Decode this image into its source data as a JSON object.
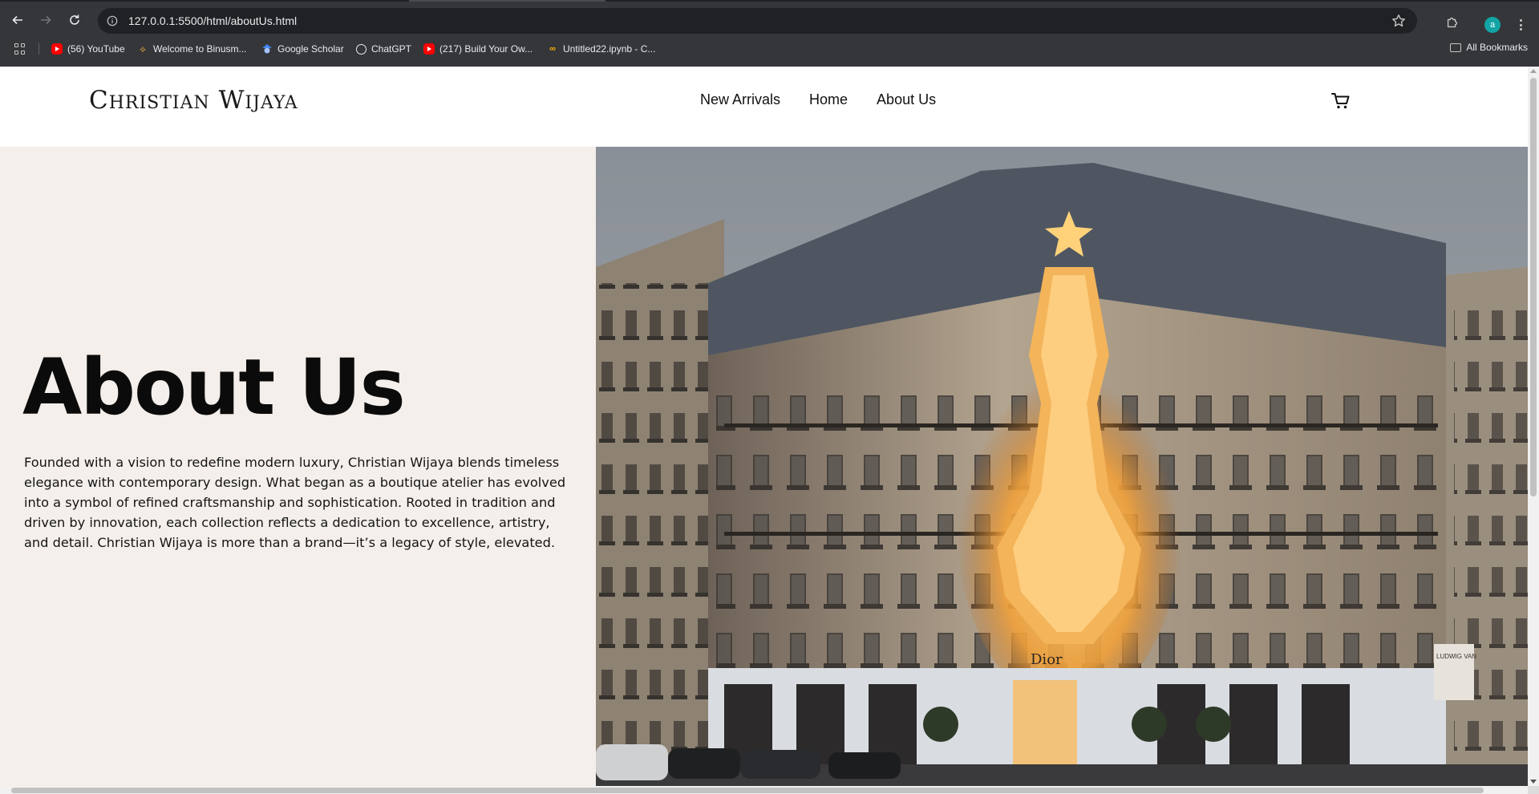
{
  "browser": {
    "url": "127.0.0.1:5500/html/aboutUs.html",
    "profile_initial": "a",
    "bookmarks": [
      {
        "label": "(56) YouTube",
        "icon": "youtube-icon"
      },
      {
        "label": "Welcome to Binusm...",
        "icon": "binusmaya-icon"
      },
      {
        "label": "Google Scholar",
        "icon": "google-scholar-icon"
      },
      {
        "label": "ChatGPT",
        "icon": "chatgpt-icon"
      },
      {
        "label": "(217) Build Your Ow...",
        "icon": "youtube-icon"
      },
      {
        "label": "Untitled22.ipynb - C...",
        "icon": "colab-icon"
      }
    ],
    "all_bookmarks_label": "All Bookmarks"
  },
  "header": {
    "logo": "Christian Wijaya",
    "nav": [
      {
        "label": "New Arrivals"
      },
      {
        "label": "Home"
      },
      {
        "label": "About Us"
      }
    ],
    "cart_icon": "cart-icon"
  },
  "hero": {
    "title": "About Us",
    "body": "Founded with a vision to redefine modern luxury, Christian Wijaya blends timeless elegance with contemporary design. What began as a boutique atelier has evolved into a symbol of refined craftsmanship and sophistication. Rooted in tradition and driven by innovation, each collection reflects a dedication to excellence, artistry, and detail. Christian Wijaya is more than a brand—it’s a legacy of style, elevated.",
    "image": {
      "storefront_sign": "Dior",
      "banner_text": "LUDWIG VAN"
    }
  },
  "colors": {
    "hero_background": "#f4efeb",
    "header_background": "#ffffff",
    "browser_chrome": "#35363a"
  }
}
